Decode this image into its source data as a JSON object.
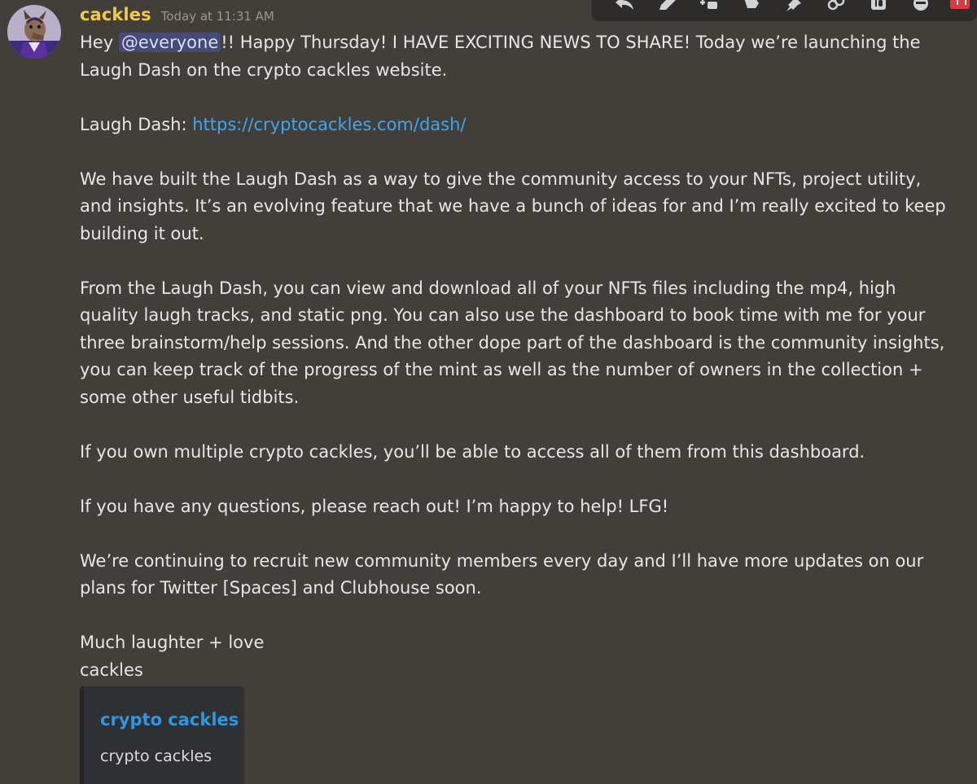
{
  "message": {
    "author": "cackles",
    "timestamp": "Today at 11:31 AM",
    "line1_prefix": "Hey ",
    "mention": "@everyone",
    "line1_suffix": "!! Happy Thursday! I HAVE EXCITING NEWS TO SHARE! Today we’re launching the",
    "line2": "Laugh Dash on the crypto cackles website.",
    "link_label": "Laugh Dash: ",
    "link_url": "https://cryptocackles.com/dash/",
    "para2_line1": "We have built the Laugh Dash as a way to give the community access to your NFTs, project utility,",
    "para2_line2": "and insights. It’s an evolving feature that we have a bunch of ideas for and I’m really excited to keep",
    "para2_line3": "building it out.",
    "para3_line1": "From the Laugh Dash, you can view and download all of your NFTs files including the mp4, high",
    "para3_line2": "quality laugh tracks, and static png. You can also use the dashboard to book time with me for your",
    "para3_line3": "three brainstorm/help sessions. And the other dope part of the dashboard is the community insights,",
    "para3_line4": "you can keep track of the progress of the mint as well as the number of owners in the collection +",
    "para3_line5": "some other useful tidbits.",
    "para4": "If you own multiple crypto cackles, you’ll be able to access all of them from this dashboard.",
    "para5": "If you have any questions, please reach out! I’m happy to help! LFG!",
    "para6_line1": "We’re continuing to recruit new community members every day and I’ll have more updates on our",
    "para6_line2": "plans for Twitter [Spaces] and Clubhouse soon.",
    "signoff_line1": "Much laughter + love",
    "signoff_line2": "cackles"
  },
  "embed": {
    "title": "crypto cackles",
    "description": "crypto cackles"
  },
  "toolbar": {
    "icons": [
      "reply-icon",
      "edit-icon",
      "add-reaction-icon",
      "thread-icon",
      "pin-icon",
      "link-icon",
      "id-icon",
      "more-icon",
      "delete-icon"
    ]
  },
  "colors": {
    "background": "#423f3b",
    "username": "#f0c94a",
    "link": "#3fa5ee",
    "embed_title": "#2f96e0",
    "mention_bg": "#5865f2",
    "delete": "#d83c3e"
  }
}
